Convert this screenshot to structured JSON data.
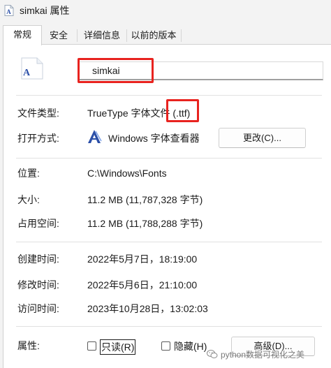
{
  "window": {
    "title": "simkai 属性"
  },
  "tabs": [
    {
      "label": "常规",
      "active": true
    },
    {
      "label": "安全",
      "active": false
    },
    {
      "label": "详细信息",
      "active": false
    },
    {
      "label": "以前的版本",
      "active": false
    }
  ],
  "general": {
    "file_name": "simkai",
    "file_type_label": "文件类型:",
    "file_type_value": "TrueType 字体文件 (.ttf)",
    "opens_with_label": "打开方式:",
    "opens_with_value": "Windows 字体查看器",
    "change_button": "更改(C)...",
    "location_label": "位置:",
    "location_value": "C:\\Windows\\Fonts",
    "size_label": "大小:",
    "size_value": "11.2 MB (11,787,328 字节)",
    "size_on_disk_label": "占用空间:",
    "size_on_disk_value": "11.2 MB (11,788,288 字节)",
    "created_label": "创建时间:",
    "created_value": "2022年5月7日，18:19:00",
    "modified_label": "修改时间:",
    "modified_value": "2022年5月6日，21:10:00",
    "accessed_label": "访问时间:",
    "accessed_value": "2023年10月28日，13:02:03",
    "attributes_label": "属性:",
    "readonly_label": "只读(R)",
    "readonly_checked": false,
    "hidden_label": "隐藏(H)",
    "hidden_checked": false,
    "advanced_button": "高级(D)..."
  },
  "watermark": "python数据可视化之美",
  "colors": {
    "highlight_box": "#e8231f",
    "window_bg": "#f3f3f3",
    "panel_bg": "#ffffff"
  },
  "icons": {
    "title": "font-file-icon",
    "file": "font-file-icon",
    "opens_with": "font-viewer-icon",
    "watermark": "wechat-icon"
  }
}
